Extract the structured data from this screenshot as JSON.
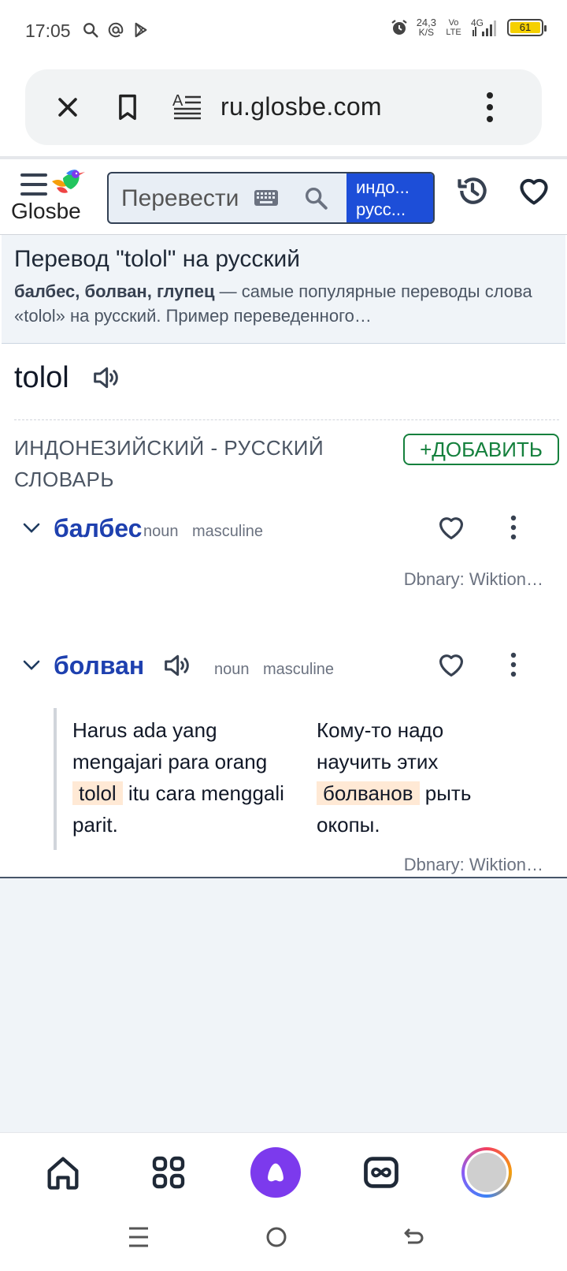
{
  "status_bar": {
    "time": "17:05",
    "net_speed": "24,3",
    "net_unit": "K/S",
    "volte": "Vo LTE",
    "network": "4G",
    "battery": "61"
  },
  "browser": {
    "url": "ru.glosbe.com",
    "close_icon": "close-icon",
    "bookmark_icon": "bookmark-icon",
    "reader_icon": "reader-mode-icon",
    "menu_icon": "more-vert-icon"
  },
  "header": {
    "logo_text": "Glosbe",
    "search_placeholder": "Перевести",
    "lang_pair_line1": "индо...",
    "lang_pair_line2": "русс..."
  },
  "summary": {
    "title": "Перевод \"tolol\" на русский",
    "bold_part": "балбес, болван, глупец",
    "rest": " — самые популярные переводы слова «tolol» на русский. Пример переведенного…"
  },
  "word": "tolol",
  "dictionary": {
    "title": "ИНДОНЕЗИЙСКИЙ - РУССКИЙ СЛОВАРЬ",
    "add_label": "+ДОБАВИТЬ"
  },
  "entries": [
    {
      "word": "балбес",
      "pos": "noun",
      "gender": "masculine",
      "source": "Dbnary: Wiktion…"
    },
    {
      "word": "болван",
      "pos": "noun",
      "gender": "masculine",
      "source": "Dbnary: Wiktion…",
      "example": {
        "src_before": "Harus ada yang mengajari para orang ",
        "src_highlight": "tolol",
        "src_after": " itu cara menggali parit.",
        "dst_before": "Кому-то надо научить этих ",
        "dst_highlight": "болванов",
        "dst_after": " рыть окопы."
      }
    }
  ],
  "colors": {
    "accent_blue": "#1d4ed8",
    "link_blue": "#1e40af",
    "add_green": "#15803d",
    "highlight": "#ffe9d5",
    "alice_purple": "#7c3aed"
  }
}
